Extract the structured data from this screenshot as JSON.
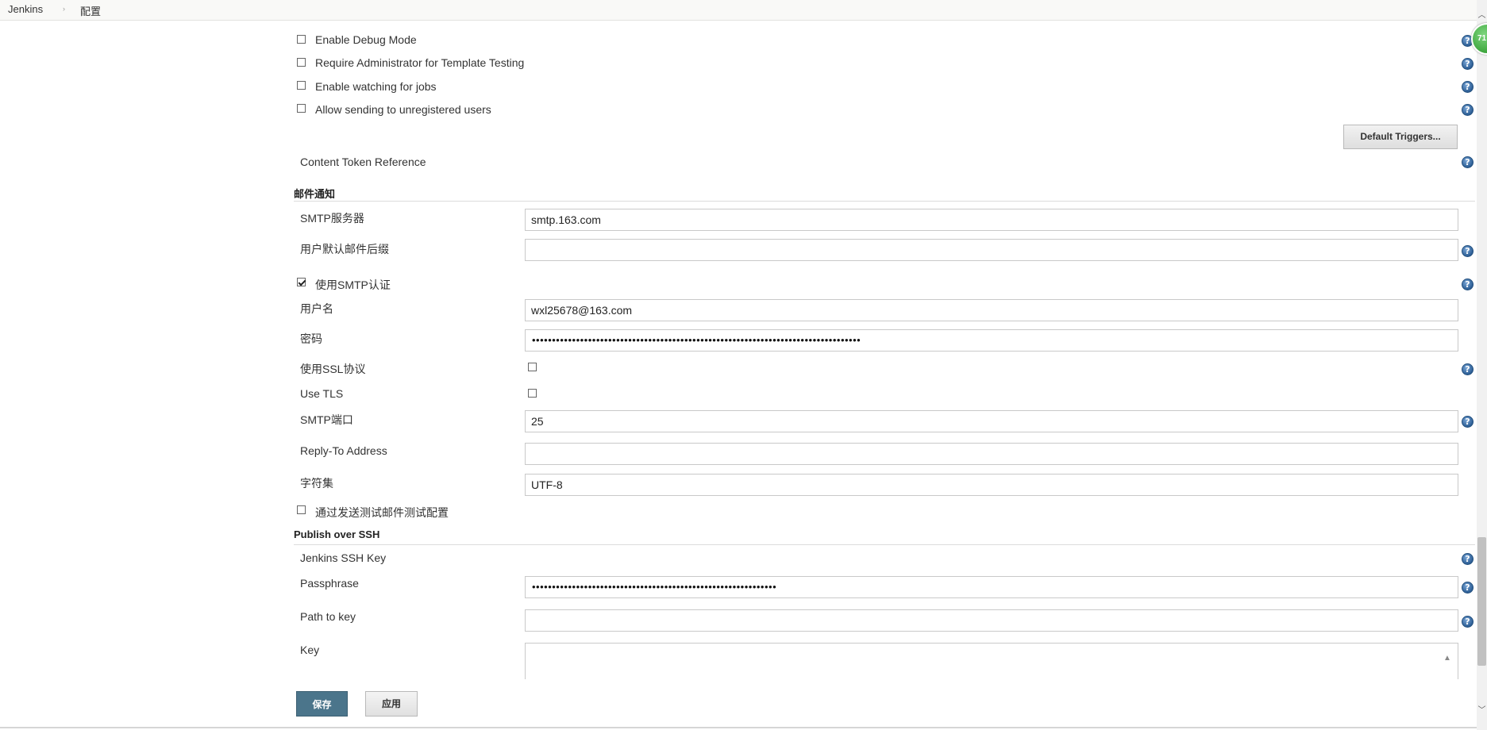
{
  "breadcrumb": {
    "items": [
      {
        "label": "Jenkins"
      },
      {
        "label": "配置"
      }
    ],
    "separator": "›"
  },
  "checkboxes_top": [
    {
      "label": "Enable Debug Mode",
      "checked": false
    },
    {
      "label": "Require Administrator for Template Testing",
      "checked": false
    },
    {
      "label": "Enable watching for jobs",
      "checked": false
    },
    {
      "label": "Allow sending to unregistered users",
      "checked": false
    }
  ],
  "default_triggers_button": "Default Triggers...",
  "content_token_reference": "Content Token Reference",
  "email_section": {
    "title": "邮件通知",
    "smtp_server": {
      "label": "SMTP服务器",
      "value": "smtp.163.com"
    },
    "default_suffix": {
      "label": "用户默认邮件后缀",
      "value": ""
    },
    "use_smtp_auth": {
      "label": "使用SMTP认证",
      "checked": true
    },
    "username": {
      "label": "用户名",
      "value": "wxl25678@163.com"
    },
    "password": {
      "label": "密码",
      "value": "••••••••••••••••••••••••••••••••••••••••••••••••••••••••••••••••••••••••••••••••••"
    },
    "use_ssl": {
      "label": "使用SSL协议",
      "checked": false
    },
    "use_tls": {
      "label": "Use TLS",
      "checked": false
    },
    "smtp_port": {
      "label": "SMTP端口",
      "value": "25"
    },
    "reply_to": {
      "label": "Reply-To Address",
      "value": ""
    },
    "charset": {
      "label": "字符集",
      "value": "UTF-8"
    },
    "test_config": {
      "label": "通过发送测试邮件测试配置",
      "checked": false
    }
  },
  "ssh_section": {
    "title": "Publish over SSH",
    "jenkins_ssh_key": "Jenkins SSH Key",
    "passphrase": {
      "label": "Passphrase",
      "value": "•••••••••••••••••••••••••••••••••••••••••••••••••••••••••••••"
    },
    "path_to_key": {
      "label": "Path to key",
      "value": ""
    },
    "key": {
      "label": "Key",
      "value": ""
    }
  },
  "buttons": {
    "save": "保存",
    "apply": "应用"
  },
  "help_icon_glyph": "?",
  "notification_badge": "71",
  "colors": {
    "save_button": "#4b758b",
    "help_icon": "#2d5f96",
    "badge": "#3ea63e"
  }
}
